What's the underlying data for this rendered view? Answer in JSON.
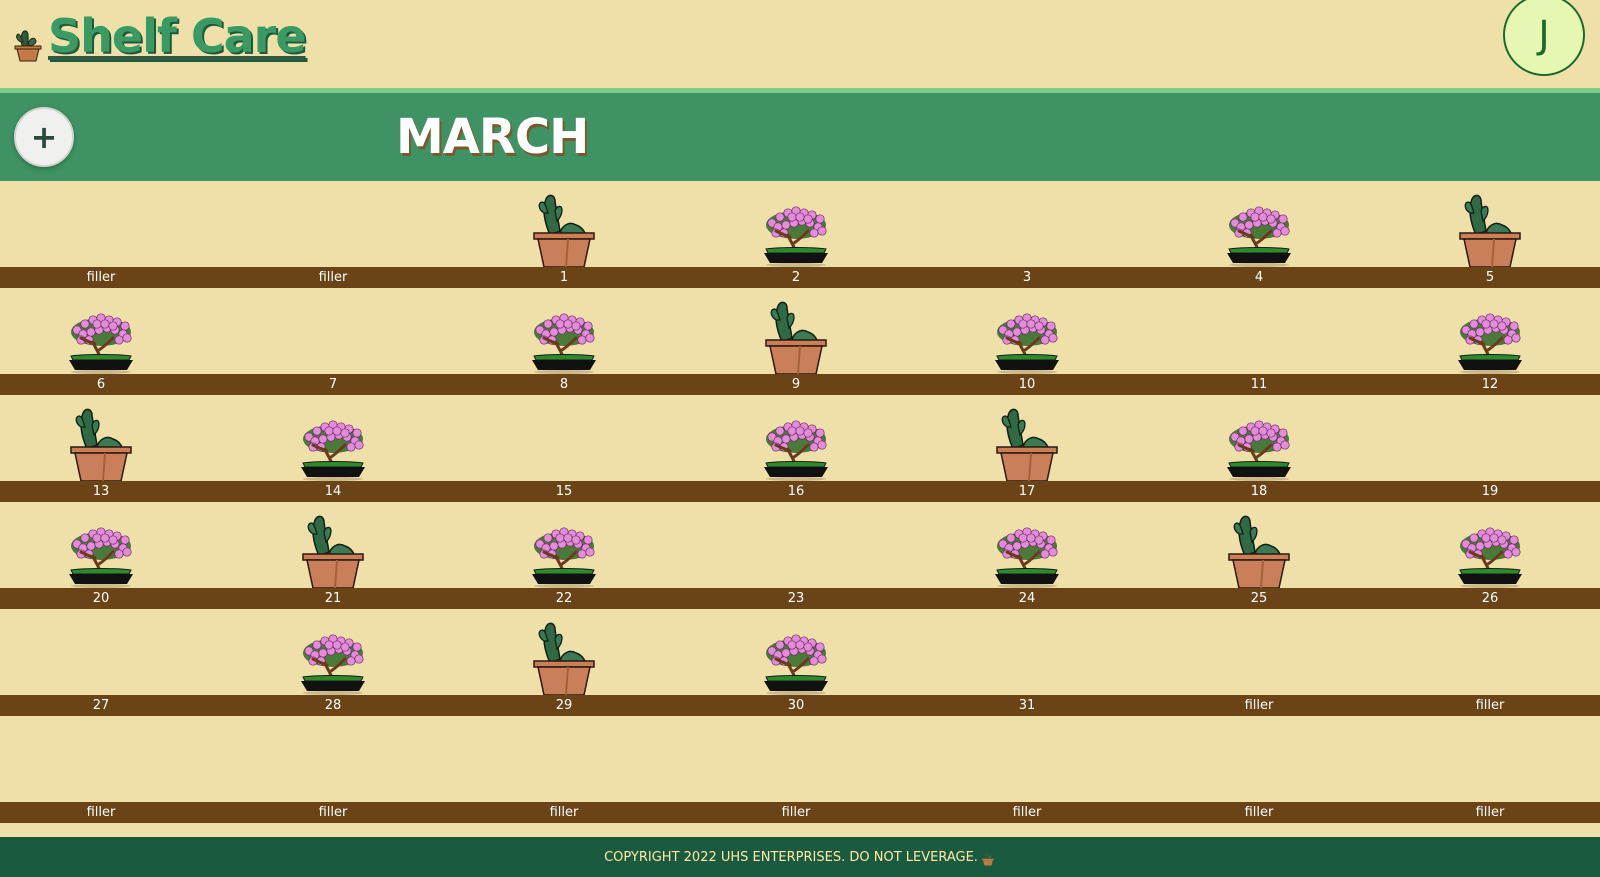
{
  "app": {
    "title": "Shelf Care"
  },
  "user": {
    "initial": "J"
  },
  "toolbar": {
    "add_label": "+"
  },
  "month": {
    "name": "MARCH"
  },
  "calendar": {
    "weeks": [
      [
        {
          "label": "filler",
          "plant": "none"
        },
        {
          "label": "filler",
          "plant": "none"
        },
        {
          "label": "1",
          "plant": "cactus"
        },
        {
          "label": "2",
          "plant": "bonsai"
        },
        {
          "label": "3",
          "plant": "none"
        },
        {
          "label": "4",
          "plant": "bonsai"
        },
        {
          "label": "5",
          "plant": "cactus"
        }
      ],
      [
        {
          "label": "6",
          "plant": "bonsai"
        },
        {
          "label": "7",
          "plant": "none"
        },
        {
          "label": "8",
          "plant": "bonsai"
        },
        {
          "label": "9",
          "plant": "cactus"
        },
        {
          "label": "10",
          "plant": "bonsai"
        },
        {
          "label": "11",
          "plant": "none"
        },
        {
          "label": "12",
          "plant": "bonsai"
        }
      ],
      [
        {
          "label": "13",
          "plant": "cactus"
        },
        {
          "label": "14",
          "plant": "bonsai"
        },
        {
          "label": "15",
          "plant": "none"
        },
        {
          "label": "16",
          "plant": "bonsai"
        },
        {
          "label": "17",
          "plant": "cactus"
        },
        {
          "label": "18",
          "plant": "bonsai"
        },
        {
          "label": "19",
          "plant": "none"
        }
      ],
      [
        {
          "label": "20",
          "plant": "bonsai"
        },
        {
          "label": "21",
          "plant": "cactus"
        },
        {
          "label": "22",
          "plant": "bonsai"
        },
        {
          "label": "23",
          "plant": "none"
        },
        {
          "label": "24",
          "plant": "bonsai"
        },
        {
          "label": "25",
          "plant": "cactus"
        },
        {
          "label": "26",
          "plant": "bonsai"
        }
      ],
      [
        {
          "label": "27",
          "plant": "none"
        },
        {
          "label": "28",
          "plant": "bonsai"
        },
        {
          "label": "29",
          "plant": "cactus"
        },
        {
          "label": "30",
          "plant": "bonsai"
        },
        {
          "label": "31",
          "plant": "none"
        },
        {
          "label": "filler",
          "plant": "none"
        },
        {
          "label": "filler",
          "plant": "none"
        }
      ],
      [
        {
          "label": "filler",
          "plant": "none"
        },
        {
          "label": "filler",
          "plant": "none"
        },
        {
          "label": "filler",
          "plant": "none"
        },
        {
          "label": "filler",
          "plant": "none"
        },
        {
          "label": "filler",
          "plant": "none"
        },
        {
          "label": "filler",
          "plant": "none"
        },
        {
          "label": "filler",
          "plant": "none"
        }
      ]
    ]
  },
  "footer": {
    "text": "COPYRIGHT 2022 UHS ENTERPRISES. DO NOT LEVERAGE."
  },
  "colors": {
    "background": "#efe0aa",
    "brand_green": "#3a9a63",
    "month_bar": "#3e9263",
    "shelf": "#6a4416",
    "footer": "#1a5a3e",
    "footer_text": "#ffe9a8"
  }
}
